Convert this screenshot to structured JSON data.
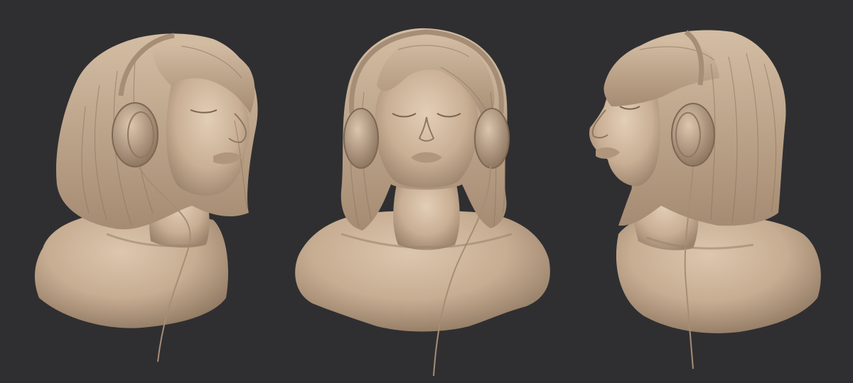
{
  "scene": {
    "background_color": "#2f2f31",
    "clay_color": "#c7ad92",
    "clay_highlight": "#dcc6ad",
    "clay_shadow": "#8f7761",
    "clay_deep_shadow": "#6b5746",
    "views": [
      {
        "view": "three-quarter-right"
      },
      {
        "view": "front"
      },
      {
        "view": "profile-left"
      }
    ]
  }
}
